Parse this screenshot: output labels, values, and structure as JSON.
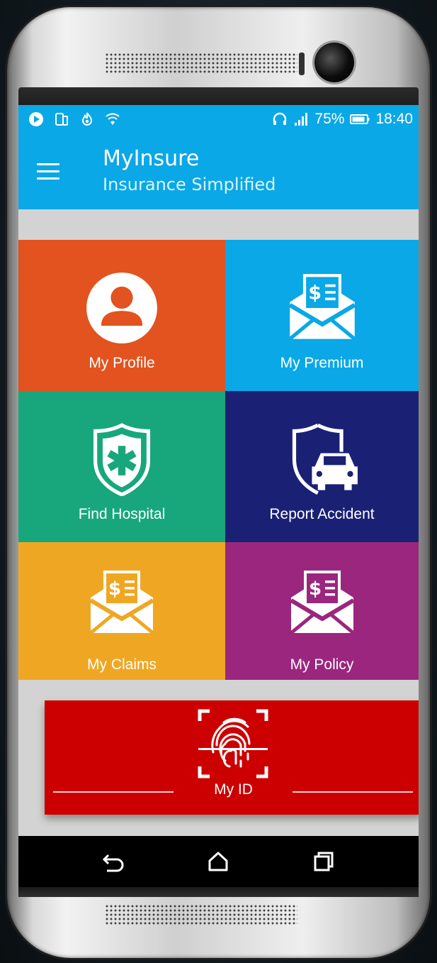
{
  "status_bar": {
    "battery": "75%",
    "time": "18:40",
    "icons_left": [
      "play-store-icon",
      "phone-sync-icon",
      "flame-app-icon",
      "shield-wifi-icon"
    ],
    "icons_right": [
      "headset-icon",
      "signal-icon",
      "battery-icon"
    ]
  },
  "app_bar": {
    "title": "MyInsure",
    "subtitle": "Insurance Simplified",
    "menu_icon": "menu-icon"
  },
  "tiles": [
    {
      "label": "My Profile",
      "color": "#e2531f",
      "icon": "user-avatar-icon"
    },
    {
      "label": "My Premium",
      "color": "#0aa8e6",
      "icon": "envelope-invoice-icon"
    },
    {
      "label": "Find Hospital",
      "color": "#18a77c",
      "icon": "medical-shield-icon"
    },
    {
      "label": "Report Accident",
      "color": "#1a2174",
      "icon": "car-shield-icon"
    },
    {
      "label": "My Claims",
      "color": "#efa723",
      "icon": "envelope-invoice-icon"
    },
    {
      "label": "My Policy",
      "color": "#9b267e",
      "icon": "envelope-invoice-icon"
    }
  ],
  "my_id": {
    "label": "My ID",
    "color": "#cc0000",
    "icon": "fingerprint-scan-icon"
  },
  "nav_bar": {
    "buttons": [
      "back-icon",
      "home-icon",
      "recent-apps-icon"
    ]
  },
  "colors": {
    "app_bar": "#0aa8e6",
    "screen_background": "#d3d3d3"
  }
}
